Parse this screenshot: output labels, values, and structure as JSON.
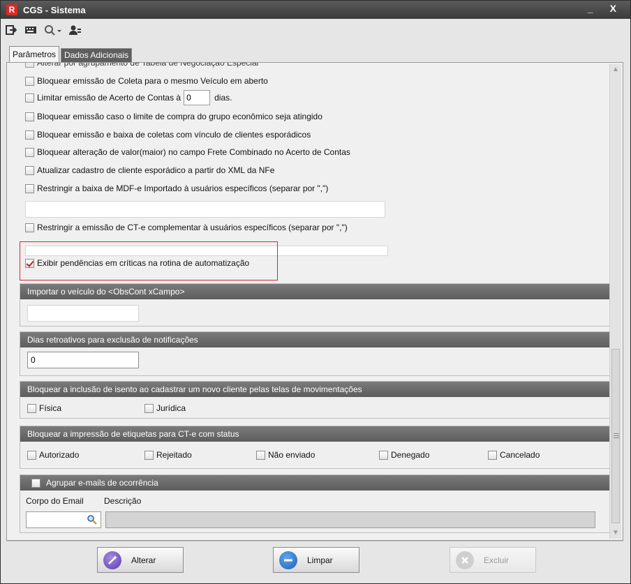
{
  "window": {
    "title": "CGS - Sistema",
    "app_icon_letter": "R",
    "controls": "_ X"
  },
  "toolbar": {
    "icons": [
      "exit-icon",
      "keyboard-icon",
      "search-dropdown-icon",
      "users-icon"
    ]
  },
  "tabs": [
    {
      "label": "Parâmetros"
    },
    {
      "label": "Dados Adicionais"
    }
  ],
  "options": {
    "partial_top": "Alterar por agrupamento de Tabela de Negociação Especial",
    "coleta": "Bloquear emissão de Coleta para o mesmo Veículo em aberto",
    "acerto_prefix": "Limitar emissão de Acerto de Contas à",
    "acerto_value": "0",
    "acerto_suffix": "dias.",
    "limite_compra": "Bloquear emissão caso o limite de compra do grupo econômico seja atingido",
    "coletas_esporadicos": "Bloquear emissão e baixa de coletas com vínculo de clientes esporádicos",
    "frete_combinado": "Bloquear alteração de valor(maior) no campo Frete Combinado no Acerto de Contas",
    "cadastro_esporadico": "Atualizar cadastro de cliente esporádico a partir do XML da NFe",
    "mdfe": "Restringir a baixa de MDF-e Importado à usuários específicos (separar por \",\")",
    "mdfe_value": "",
    "cte_complementar": "Restringir a emissão de CT-e complementar à usuários específicos (separar por \",\")",
    "cte_value": "",
    "pendencias": "Exibir pendências em críticas na rotina de automatização"
  },
  "groups": {
    "veiculo": {
      "header": "Importar o veículo do <ObsCont xCampo>",
      "value": ""
    },
    "dias": {
      "header": "Dias retroativos para exclusão de notificações",
      "value": "0"
    },
    "isento": {
      "header": "Bloquear a inclusão de isento ao cadastrar um novo cliente pelas telas de movimentações",
      "options": [
        "Física",
        "Jurídica"
      ]
    },
    "etiquetas": {
      "header": "Bloquear a impressão de etiquetas para CT-e com status",
      "options": [
        "Autorizado",
        "Rejeitado",
        "Não enviado",
        "Denegado",
        "Cancelado"
      ]
    },
    "emails": {
      "header": "Agrupar e-mails de ocorrência",
      "corpo_label": "Corpo do Email",
      "descricao_label": "Descrição",
      "corpo_value": "",
      "descricao_value": ""
    }
  },
  "buttons": {
    "alterar": "Alterar",
    "limpar": "Limpar",
    "excluir": "Excluir"
  },
  "colors": {
    "accent_red": "#d8252a",
    "header_gray": "#6a6a6a"
  }
}
